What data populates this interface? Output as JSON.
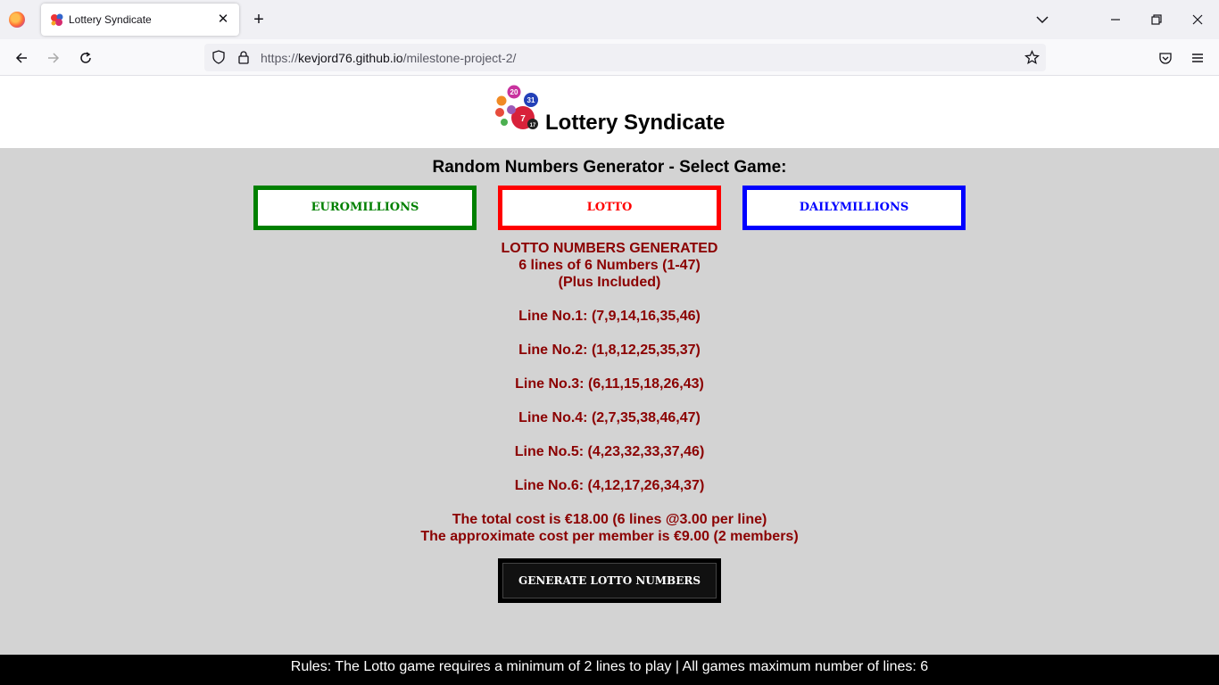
{
  "browser": {
    "tab_title": "Lottery Syndicate",
    "url_prefix": "https://",
    "url_host": "kevjord76.github.io",
    "url_path": "/milestone-project-2/"
  },
  "site": {
    "title": "Lottery Syndicate",
    "logo_ball_numbers": [
      "20",
      "31",
      "7",
      "17"
    ]
  },
  "generator": {
    "heading": "Random Numbers Generator - Select Game:",
    "games": [
      "EUROMILLIONS",
      "LOTTO",
      "DAILYMILLIONS"
    ],
    "selected_game": "LOTTO"
  },
  "results": {
    "heading": "LOTTO NUMBERS GENERATED",
    "subheading": "6 lines of 6 Numbers (1-47)",
    "note": "(Plus Included)",
    "lines": [
      "Line No.1: (7,9,14,16,35,46)",
      "Line No.2: (1,8,12,25,35,37)",
      "Line No.3: (6,11,15,18,26,43)",
      "Line No.4: (2,7,35,38,46,47)",
      "Line No.5: (4,23,32,33,37,46)",
      "Line No.6: (4,12,17,26,34,37)"
    ],
    "total_cost": "The total cost is €18.00 (6 lines @3.00 per line)",
    "member_cost": "The approximate cost per member is €9.00 (2 members)"
  },
  "generate_button": "GENERATE LOTTO NUMBERS",
  "footer": "Rules: The Lotto game requires a minimum of 2 lines to play | All games maximum number of lines: 6",
  "colors": {
    "euromillions": "#008000",
    "lotto": "#ff0000",
    "dailymillions": "#0000ff",
    "results_text": "#8b0000",
    "page_bg": "#d3d3d3"
  }
}
